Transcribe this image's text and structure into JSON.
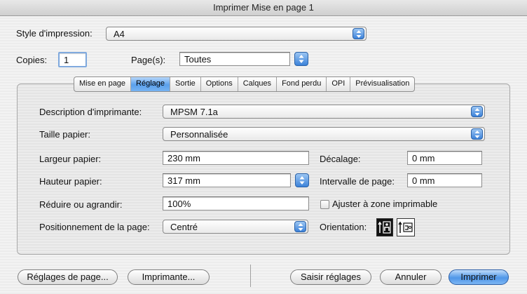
{
  "window": {
    "title": "Imprimer Mise en page 1"
  },
  "style": {
    "label": "Style d'impression:",
    "value": "A4"
  },
  "copies": {
    "label": "Copies:",
    "value": "1"
  },
  "pages": {
    "label": "Page(s):",
    "value": "Toutes"
  },
  "tabs": [
    "Mise en page",
    "Réglage",
    "Sortie",
    "Options",
    "Calques",
    "Fond perdu",
    "OPI",
    "Prévisualisation"
  ],
  "active_tab": "Réglage",
  "form": {
    "printer_desc": {
      "label": "Description d'imprimante:",
      "value": "MPSM 7.1a"
    },
    "paper_size": {
      "label": "Taille papier:",
      "value": "Personnalisée"
    },
    "paper_width": {
      "label": "Largeur papier:",
      "value": "230 mm"
    },
    "paper_height": {
      "label": "Hauteur papier:",
      "value": "317 mm"
    },
    "scale": {
      "label": "Réduire ou agrandir:",
      "value": "100%"
    },
    "positioning": {
      "label": "Positionnement de la page:",
      "value": "Centré"
    },
    "offset": {
      "label": "Décalage:",
      "value": "0 mm"
    },
    "page_gap": {
      "label": "Intervalle de page:",
      "value": "0 mm"
    },
    "fit_printable": {
      "label": "Ajuster à zone imprimable",
      "checked": false
    },
    "orientation": {
      "label": "Orientation:"
    }
  },
  "buttons": {
    "page_setup": "Réglages de page...",
    "printer": "Imprimante...",
    "capture": "Saisir réglages",
    "cancel": "Annuler",
    "print": "Imprimer"
  },
  "colors": {
    "accent": "#4f96e8",
    "window_bg": "#eeeeee"
  }
}
